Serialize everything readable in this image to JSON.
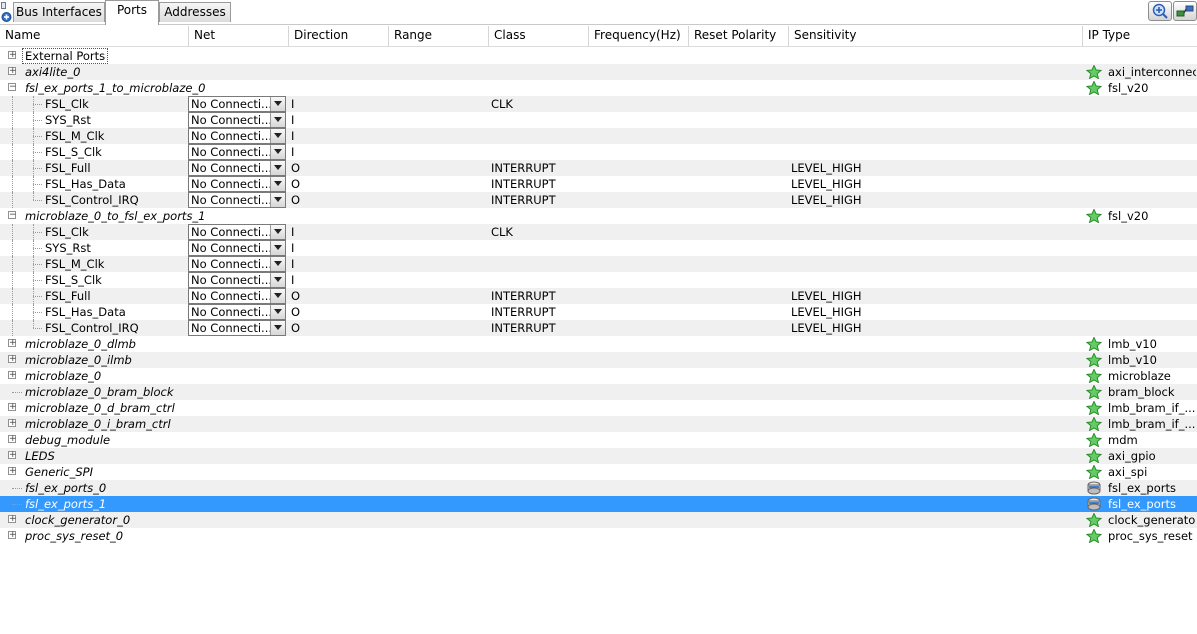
{
  "tabs": [
    {
      "label": "Bus Interfaces",
      "active": false
    },
    {
      "label": "Ports",
      "active": true
    },
    {
      "label": "Addresses",
      "active": false
    }
  ],
  "toolbar": {
    "buttons": [
      "zoom-icon",
      "connect-icon"
    ]
  },
  "columns": [
    "Name",
    "Net",
    "Direction",
    "Range",
    "Class",
    "Frequency(Hz)",
    "Reset Polarity",
    "Sensitivity",
    "IP Type"
  ],
  "rows": [
    {
      "name": "External Ports",
      "level": 0,
      "expander": "+",
      "style": "boxed"
    },
    {
      "name": "axi4lite_0",
      "level": 0,
      "expander": "+",
      "style": "italic",
      "ip_type": "axi_interconnect",
      "ip_icon": "star-icon"
    },
    {
      "name": "fsl_ex_ports_1_to_microblaze_0",
      "level": 0,
      "expander": "-",
      "style": "italic",
      "ip_type": "fsl_v20",
      "ip_icon": "star-icon"
    },
    {
      "name": "FSL_Clk",
      "level": 1,
      "net": "No Connecti...",
      "direction": "I",
      "class": "CLK"
    },
    {
      "name": "SYS_Rst",
      "level": 1,
      "net": "No Connecti...",
      "direction": "I"
    },
    {
      "name": "FSL_M_Clk",
      "level": 1,
      "net": "No Connecti...",
      "direction": "I"
    },
    {
      "name": "FSL_S_Clk",
      "level": 1,
      "net": "No Connecti...",
      "direction": "I"
    },
    {
      "name": "FSL_Full",
      "level": 1,
      "net": "No Connecti...",
      "direction": "O",
      "class": "INTERRUPT",
      "sensitivity": "LEVEL_HIGH"
    },
    {
      "name": "FSL_Has_Data",
      "level": 1,
      "net": "No Connecti...",
      "direction": "O",
      "class": "INTERRUPT",
      "sensitivity": "LEVEL_HIGH"
    },
    {
      "name": "FSL_Control_IRQ",
      "level": 1,
      "net": "No Connecti...",
      "direction": "O",
      "class": "INTERRUPT",
      "sensitivity": "LEVEL_HIGH",
      "last": true
    },
    {
      "name": "microblaze_0_to_fsl_ex_ports_1",
      "level": 0,
      "expander": "-",
      "style": "italic",
      "ip_type": "fsl_v20",
      "ip_icon": "star-icon"
    },
    {
      "name": "FSL_Clk",
      "level": 1,
      "net": "No Connecti...",
      "direction": "I",
      "class": "CLK"
    },
    {
      "name": "SYS_Rst",
      "level": 1,
      "net": "No Connecti...",
      "direction": "I"
    },
    {
      "name": "FSL_M_Clk",
      "level": 1,
      "net": "No Connecti...",
      "direction": "I"
    },
    {
      "name": "FSL_S_Clk",
      "level": 1,
      "net": "No Connecti...",
      "direction": "I"
    },
    {
      "name": "FSL_Full",
      "level": 1,
      "net": "No Connecti...",
      "direction": "O",
      "class": "INTERRUPT",
      "sensitivity": "LEVEL_HIGH"
    },
    {
      "name": "FSL_Has_Data",
      "level": 1,
      "net": "No Connecti...",
      "direction": "O",
      "class": "INTERRUPT",
      "sensitivity": "LEVEL_HIGH"
    },
    {
      "name": "FSL_Control_IRQ",
      "level": 1,
      "net": "No Connecti...",
      "direction": "O",
      "class": "INTERRUPT",
      "sensitivity": "LEVEL_HIGH",
      "last": true
    },
    {
      "name": "microblaze_0_dlmb",
      "level": 0,
      "expander": "+",
      "style": "italic",
      "ip_type": "lmb_v10",
      "ip_icon": "star-icon"
    },
    {
      "name": "microblaze_0_ilmb",
      "level": 0,
      "expander": "+",
      "style": "italic",
      "ip_type": "lmb_v10",
      "ip_icon": "star-icon"
    },
    {
      "name": "microblaze_0",
      "level": 0,
      "expander": "+",
      "style": "italic",
      "ip_type": "microblaze",
      "ip_icon": "star-icon"
    },
    {
      "name": "microblaze_0_bram_block",
      "level": 0,
      "expander": "",
      "style": "italic",
      "ip_type": "bram_block",
      "ip_icon": "star-icon"
    },
    {
      "name": "microblaze_0_d_bram_ctrl",
      "level": 0,
      "expander": "+",
      "style": "italic",
      "ip_type": "lmb_bram_if_...",
      "ip_icon": "star-icon"
    },
    {
      "name": "microblaze_0_i_bram_ctrl",
      "level": 0,
      "expander": "+",
      "style": "italic",
      "ip_type": "lmb_bram_if_...",
      "ip_icon": "star-icon"
    },
    {
      "name": "debug_module",
      "level": 0,
      "expander": "+",
      "style": "italic",
      "ip_type": "mdm",
      "ip_icon": "star-icon"
    },
    {
      "name": "LEDS",
      "level": 0,
      "expander": "+",
      "style": "italic",
      "ip_type": "axi_gpio",
      "ip_icon": "star-icon"
    },
    {
      "name": "Generic_SPI",
      "level": 0,
      "expander": "+",
      "style": "italic",
      "ip_type": "axi_spi",
      "ip_icon": "star-icon"
    },
    {
      "name": "fsl_ex_ports_0",
      "level": 0,
      "expander": "",
      "style": "italic",
      "ip_type": "fsl_ex_ports",
      "ip_icon": "custom-ip-icon"
    },
    {
      "name": "fsl_ex_ports_1",
      "level": 0,
      "expander": "",
      "style": "italic",
      "ip_type": "fsl_ex_ports",
      "ip_icon": "custom-ip-icon",
      "selected": true
    },
    {
      "name": "clock_generator_0",
      "level": 0,
      "expander": "+",
      "style": "italic",
      "ip_type": "clock_generator",
      "ip_icon": "star-icon"
    },
    {
      "name": "proc_sys_reset_0",
      "level": 0,
      "expander": "+",
      "style": "italic",
      "ip_type": "proc_sys_reset",
      "ip_icon": "star-icon"
    }
  ]
}
